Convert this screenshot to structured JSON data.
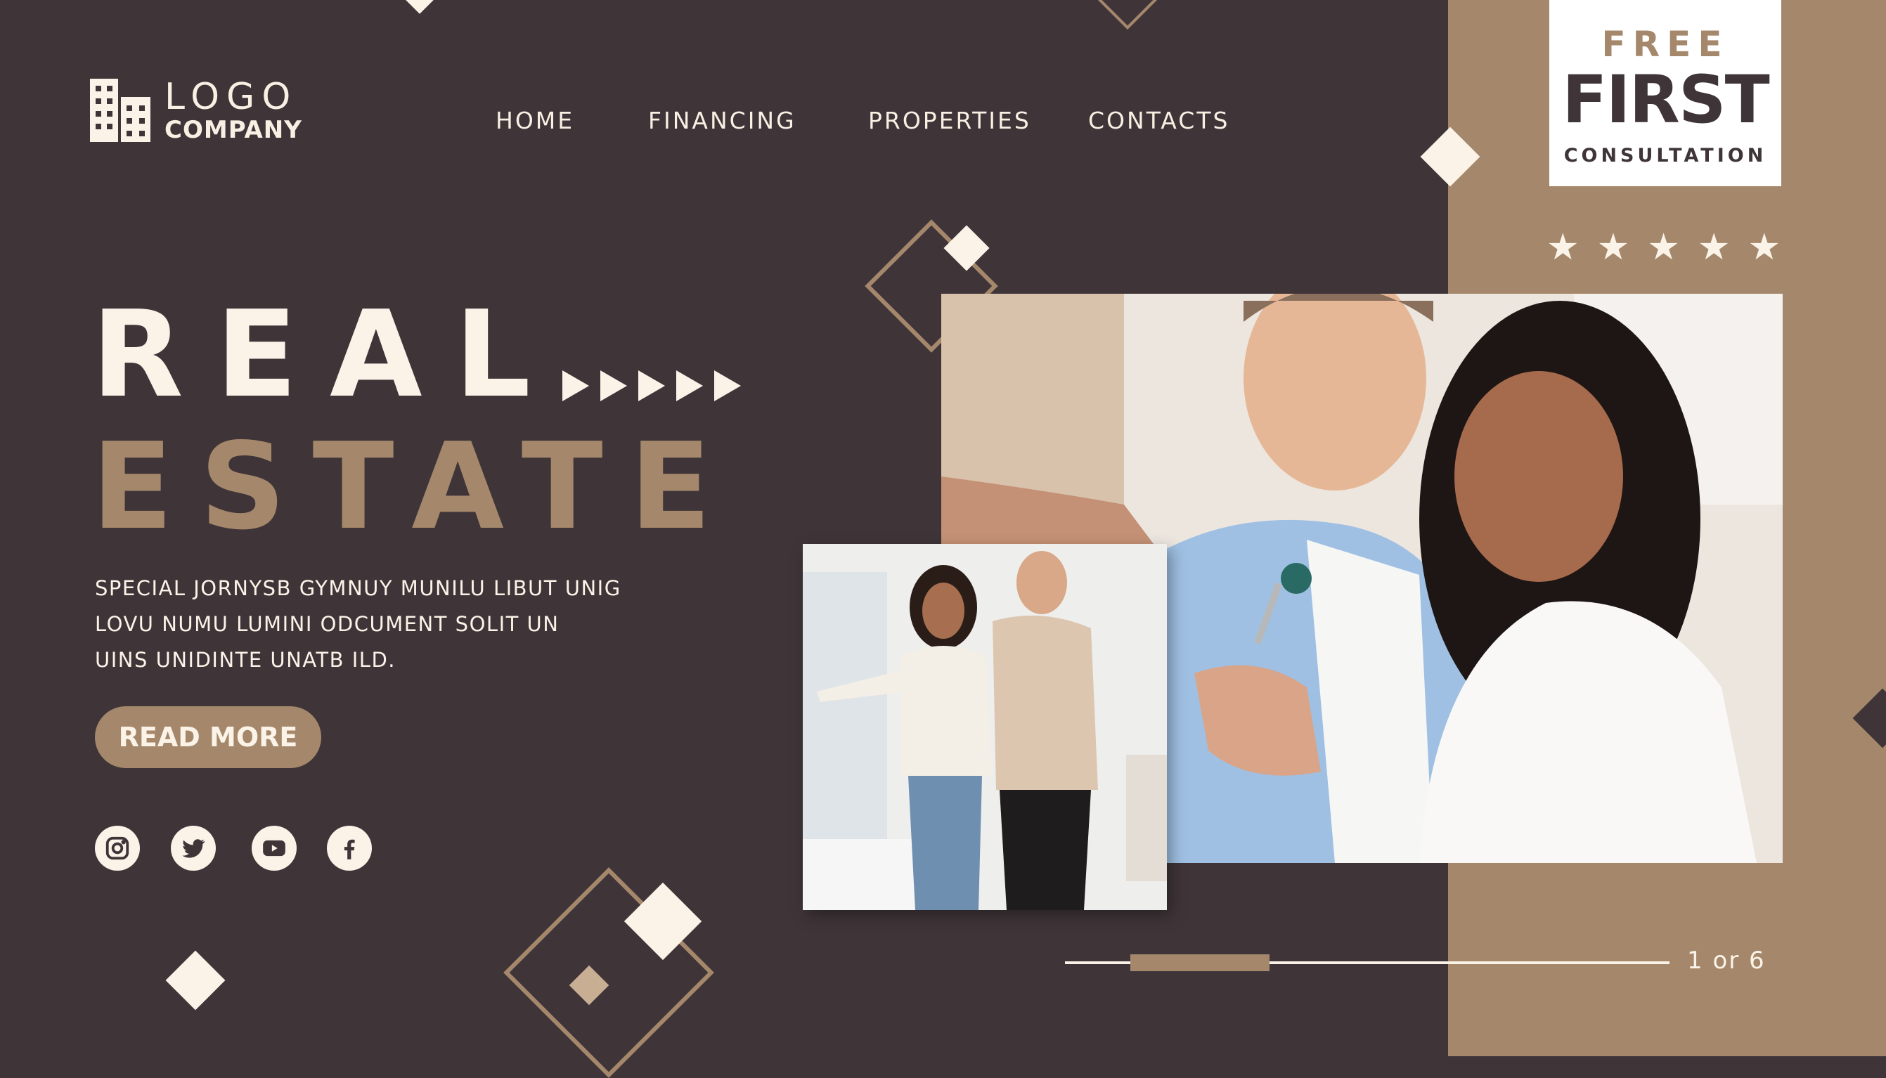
{
  "logo": {
    "title": "LOGO",
    "subtitle": "COMPANY"
  },
  "nav": {
    "items": [
      {
        "label": "HOME"
      },
      {
        "label": "FINANCING"
      },
      {
        "label": "PROPERTIES"
      },
      {
        "label": "CONTACTS"
      }
    ]
  },
  "hero": {
    "line1": "REAL",
    "line2": "ESTATE",
    "description_lines": [
      "SPECIAL JORNYSB GYMNUY MUNILU LIBUT UNIG",
      "LOVU NUMU LUMINI ODCUMENT SOLIT UN",
      "UINS UNIDINTE UNATB ILD."
    ],
    "cta_label": "READ MORE"
  },
  "social": {
    "icons": [
      "instagram-icon",
      "twitter-icon",
      "youtube-icon",
      "facebook-icon"
    ]
  },
  "badge": {
    "line1": "FREE",
    "line2": "FIRST",
    "line3": "CONSULTATION"
  },
  "rating": {
    "stars": 5
  },
  "pager": {
    "text": "1 or 6"
  },
  "colors": {
    "background": "#3f3539",
    "accent": "#a5886b",
    "cream": "#fbf3e7"
  }
}
